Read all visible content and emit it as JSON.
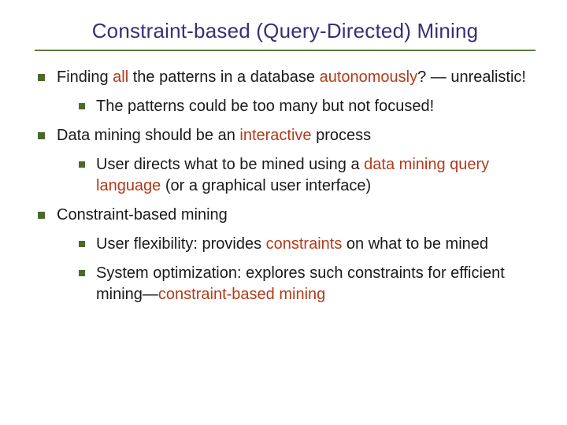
{
  "title": "Constraint-based (Query-Directed) Mining",
  "b1": {
    "pre": "Finding ",
    "em1": "all",
    "mid": " the patterns in a database ",
    "em2": "autonomously",
    "post": "? — unrealistic!",
    "sub1": "The patterns could be too many but not focused!"
  },
  "b2": {
    "pre": "Data mining should be an ",
    "em1": "interactive",
    "post": " process",
    "sub1": {
      "pre": "User directs what to be mined using a ",
      "em1": "data mining query language",
      "post": " (or a graphical user interface)"
    }
  },
  "b3": {
    "text": "Constraint-based mining",
    "sub1": {
      "pre": "User flexibility: provides ",
      "em1": "constraints",
      "post": " on what to be mined"
    },
    "sub2": {
      "pre": "System optimization: explores such constraints for efficient mining—",
      "em1": "constraint-based mining"
    }
  }
}
